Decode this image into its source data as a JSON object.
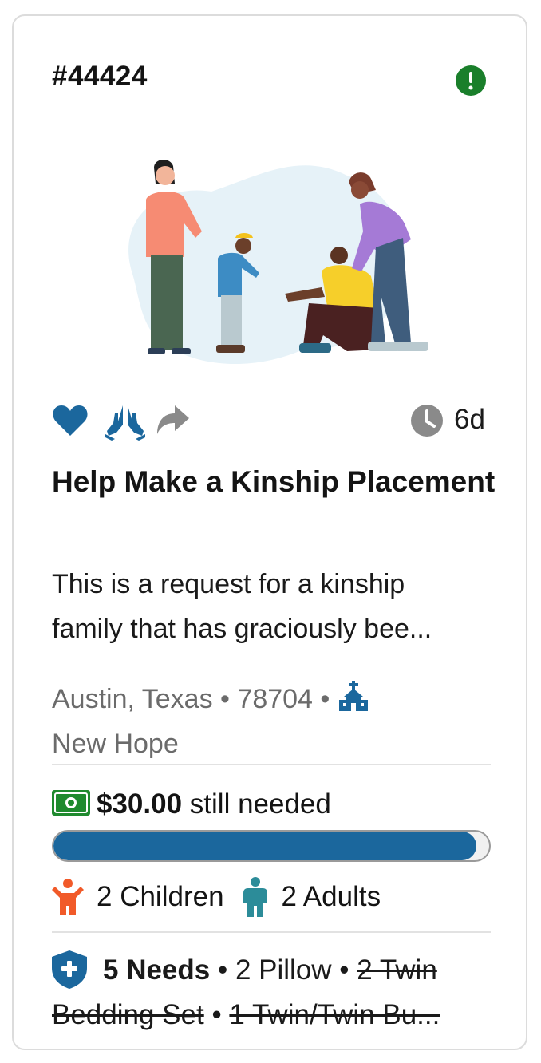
{
  "card": {
    "case_id": "#44424",
    "alert_icon": "exclamation-circle-icon",
    "age": "6d",
    "title": "Help Make a Kinship Placement",
    "description_line1": "This is a request for a kinship",
    "description_line2": "family that has graciously bee...",
    "location": {
      "city": "Austin, Texas",
      "zip": "78704",
      "organization": "New Hope",
      "separator": "•"
    },
    "funding": {
      "amount": "$30.00",
      "label": "still needed",
      "progress_fraction": 0.97
    },
    "household": {
      "children": "2 Children",
      "adults": "2 Adults"
    },
    "needs": {
      "count": "5 Needs",
      "items": [
        {
          "label": "2 Pillow",
          "fulfilled": false
        },
        {
          "label": "2 Twin",
          "fulfilled": true
        },
        {
          "label": "Bedding Set",
          "fulfilled": true
        },
        {
          "label": "1 Twin/Twin Bu...",
          "fulfilled": true
        }
      ]
    },
    "colors": {
      "accent_blue": "#1b679d",
      "alert_green": "#1a7f2b",
      "money_green": "#1f8a2e",
      "child_orange": "#f15a29",
      "adult_teal": "#2c8c99",
      "icon_gray": "#8a8a8a"
    }
  }
}
